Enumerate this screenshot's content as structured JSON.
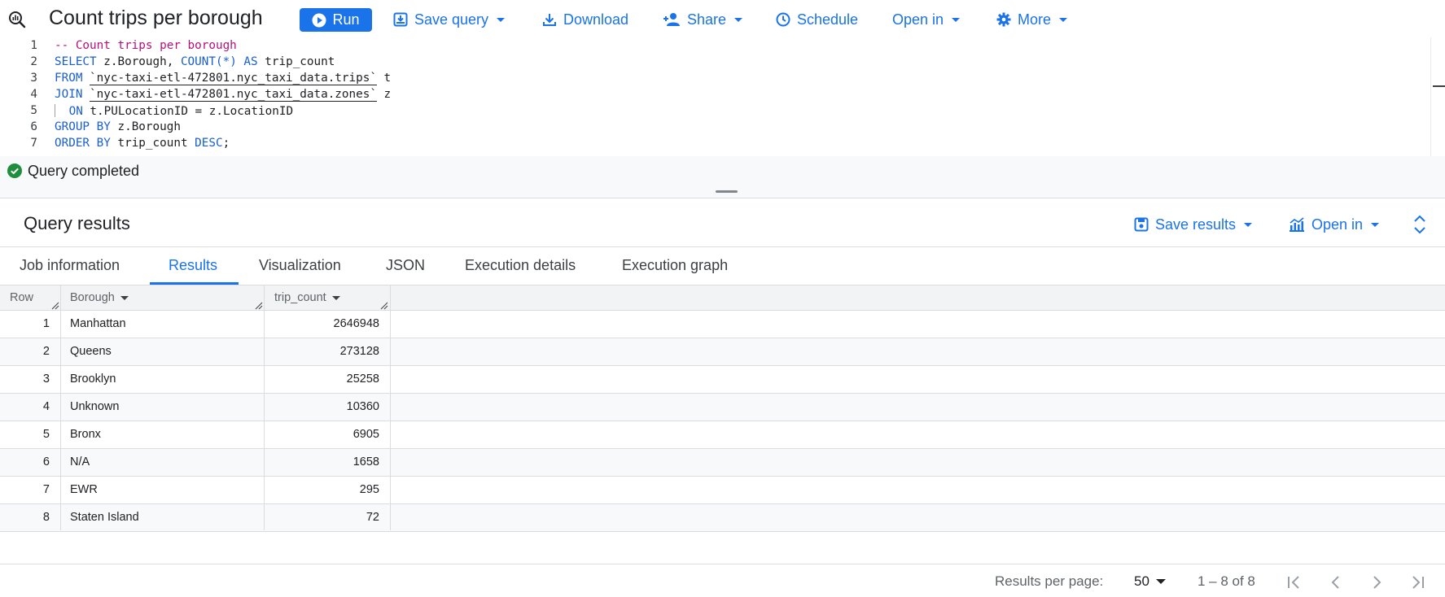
{
  "toolbar": {
    "title": "Count trips per borough",
    "run_label": "Run",
    "save_query_label": "Save query",
    "download_label": "Download",
    "share_label": "Share",
    "schedule_label": "Schedule",
    "open_in_label": "Open in",
    "more_label": "More"
  },
  "editor": {
    "line_numbers": [
      "1",
      "2",
      "3",
      "4",
      "5",
      "6",
      "7"
    ],
    "lines": [
      "-- Count trips per borough",
      "SELECT z.Borough, COUNT(*) AS trip_count",
      "FROM `nyc-taxi-etl-472801.nyc_taxi_data.trips` t",
      "JOIN `nyc-taxi-etl-472801.nyc_taxi_data.zones` z",
      "  ON t.PULocationID = z.LocationID",
      "GROUP BY z.Borough",
      "ORDER BY trip_count DESC;"
    ],
    "tokens": {
      "comment": "-- Count trips per borough",
      "select_kw": "SELECT",
      "select_rest_1": " z.Borough, ",
      "count_kw": "COUNT(*)",
      "as_kw": " AS",
      "select_rest_2": " trip_count",
      "from_kw": "FROM",
      "trips_table": "`nyc-taxi-etl-472801.nyc_taxi_data.trips`",
      "trips_alias": " t",
      "join_kw": "JOIN",
      "zones_table": "`nyc-taxi-etl-472801.nyc_taxi_data.zones`",
      "zones_alias": " z",
      "on_kw": "ON",
      "on_rest": " t.PULocationID = z.LocationID",
      "group_kw": "GROUP BY",
      "group_rest": " z.Borough",
      "order_kw": "ORDER BY",
      "order_rest": " trip_count ",
      "desc_kw": "DESC",
      "semicolon": ";"
    }
  },
  "status": {
    "text": "Query completed"
  },
  "results": {
    "title": "Query results",
    "save_results_label": "Save results",
    "open_in_label": "Open in",
    "tabs": [
      {
        "label": "Job information",
        "active": false
      },
      {
        "label": "Results",
        "active": true
      },
      {
        "label": "Visualization",
        "active": false
      },
      {
        "label": "JSON",
        "active": false
      },
      {
        "label": "Execution details",
        "active": false
      },
      {
        "label": "Execution graph",
        "active": false
      }
    ],
    "columns": [
      "Row",
      "Borough",
      "trip_count"
    ],
    "rows": [
      {
        "row": "1",
        "borough": "Manhattan",
        "trip_count": "2646948"
      },
      {
        "row": "2",
        "borough": "Queens",
        "trip_count": "273128"
      },
      {
        "row": "3",
        "borough": "Brooklyn",
        "trip_count": "25258"
      },
      {
        "row": "4",
        "borough": "Unknown",
        "trip_count": "10360"
      },
      {
        "row": "5",
        "borough": "Bronx",
        "trip_count": "6905"
      },
      {
        "row": "6",
        "borough": "N/A",
        "trip_count": "1658"
      },
      {
        "row": "7",
        "borough": "EWR",
        "trip_count": "295"
      },
      {
        "row": "8",
        "borough": "Staten Island",
        "trip_count": "72"
      }
    ]
  },
  "footer": {
    "per_page_label": "Results per page:",
    "per_page_value": "50",
    "page_range": "1 – 8 of 8"
  },
  "colors": {
    "accent": "#1a73e8",
    "success": "#1e8e3e",
    "keyword": "#1a5fd0",
    "comment": "#b5117a"
  },
  "icons": [
    "query-icon",
    "play-icon",
    "save-icon",
    "download-icon",
    "share-person-icon",
    "clock-icon",
    "gear-icon",
    "check-circle-icon",
    "chart-icon",
    "expand-collapse-icon",
    "first-page-icon",
    "prev-page-icon",
    "next-page-icon",
    "last-page-icon"
  ]
}
